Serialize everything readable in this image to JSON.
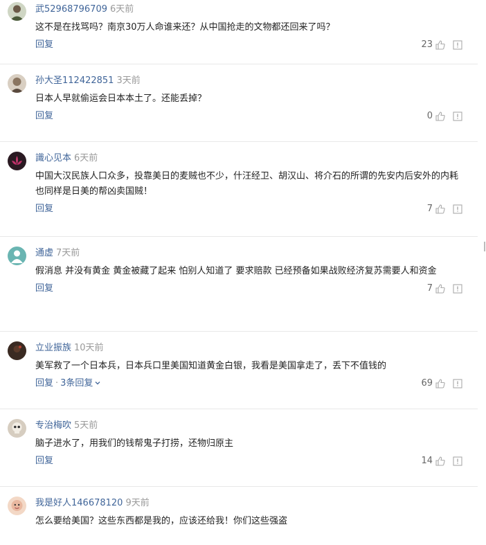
{
  "comments": [
    {
      "username": "武52968796709",
      "time": "6天前",
      "text": "这不是在找骂吗？南京30万人命谁来还？从中国抢走的文物都还回来了吗？",
      "reply_label": "回复",
      "replies_label": "",
      "likes": "23",
      "avatar_icon": "avatar-man-photo-icon",
      "avatar_color": "#7a8a6a"
    },
    {
      "username": "孙大圣112422851",
      "time": "3天前",
      "text": "日本人早就偷运会日本本土了。还能丢掉？",
      "reply_label": "回复",
      "replies_label": "",
      "likes": "0",
      "avatar_icon": "avatar-portrait-icon",
      "avatar_color": "#8a7560"
    },
    {
      "username": "識心见本",
      "time": "6天前",
      "text": "中国大汉民族人口众多，投靠美日的麦贼也不少，什汪经卫、胡汉山、将介石的所谓的先安内后安外的内耗也同样是日美的帮凶卖国贼！",
      "reply_label": "回复",
      "replies_label": "",
      "likes": "7",
      "avatar_icon": "avatar-lotus-icon",
      "avatar_color": "#c0306a"
    },
    {
      "username": "通虚",
      "time": "7天前",
      "text": "假消息 并没有黄金 黄金被藏了起来 怕别人知道了 要求赔款 已经预备如果战败经济复苏需要人和资金",
      "reply_label": "回复",
      "replies_label": "",
      "likes": "7",
      "avatar_icon": "avatar-default-teal-icon",
      "avatar_color": "#6ab5b2"
    },
    {
      "username": "立业振族",
      "time": "10天前",
      "text": "美军救了一个日本兵，日本兵口里美国知道黄金白银，我看是美国拿走了，丢下不值钱的",
      "reply_label": "回复",
      "replies_label": "3条回复",
      "likes": "69",
      "avatar_icon": "avatar-dark-photo-icon",
      "avatar_color": "#3a2a22"
    },
    {
      "username": "专治梅吹",
      "time": "5天前",
      "text": "脑子进水了，用我们的钱帮鬼子打捞，还物归原主",
      "reply_label": "回复",
      "replies_label": "",
      "likes": "14",
      "avatar_icon": "avatar-skull-icon",
      "avatar_color": "#9b8f80"
    },
    {
      "username": "我是好人146678120",
      "time": "9天前",
      "text": "怎么要给美国？这些东西都是我的，应该还给我！你们这些强盗",
      "reply_label": "回复",
      "replies_label": "",
      "likes": "",
      "avatar_icon": "avatar-cartoon-icon",
      "avatar_color": "#e9b8a0"
    }
  ],
  "icons": {
    "like": "thumbs-up-icon",
    "report": "report-icon",
    "chevron": "chevron-down-icon"
  },
  "colors": {
    "username": "#406599",
    "time": "#999999",
    "text": "#222222",
    "divider": "#e8e8e8"
  }
}
